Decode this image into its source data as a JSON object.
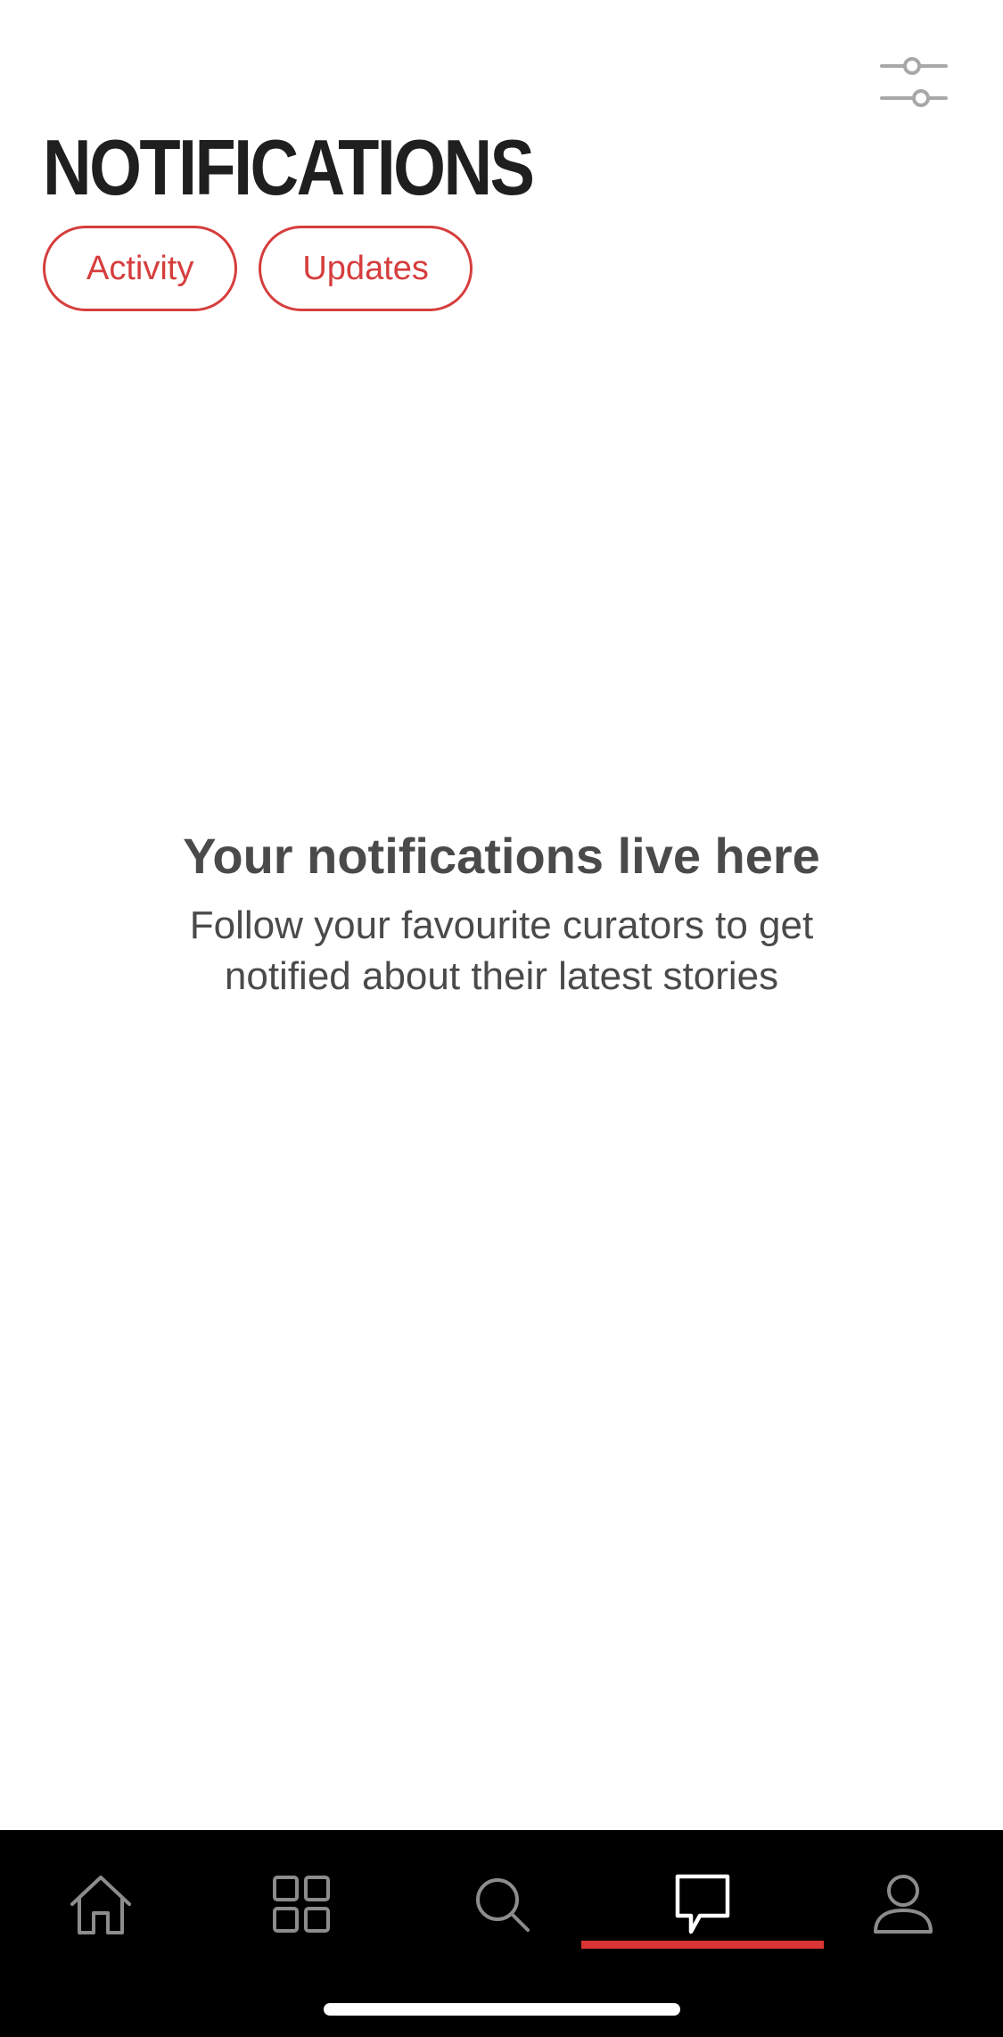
{
  "header": {
    "title": "NOTIFICATIONS",
    "filter_icon": "sliders-icon"
  },
  "tabs": [
    {
      "label": "Activity"
    },
    {
      "label": "Updates"
    }
  ],
  "empty_state": {
    "title": "Your notifications live here",
    "description": "Follow your favourite curators to get notified about their latest stories"
  },
  "nav": {
    "items": [
      {
        "icon": "home-icon"
      },
      {
        "icon": "grid-icon"
      },
      {
        "icon": "search-icon"
      },
      {
        "icon": "chat-bubble-icon",
        "active": true
      },
      {
        "icon": "profile-icon"
      }
    ]
  },
  "colors": {
    "accent": "#d63d3d",
    "tabbar_background": "#000000",
    "text": "#4a4a4a",
    "title": "#1f1f1f"
  }
}
